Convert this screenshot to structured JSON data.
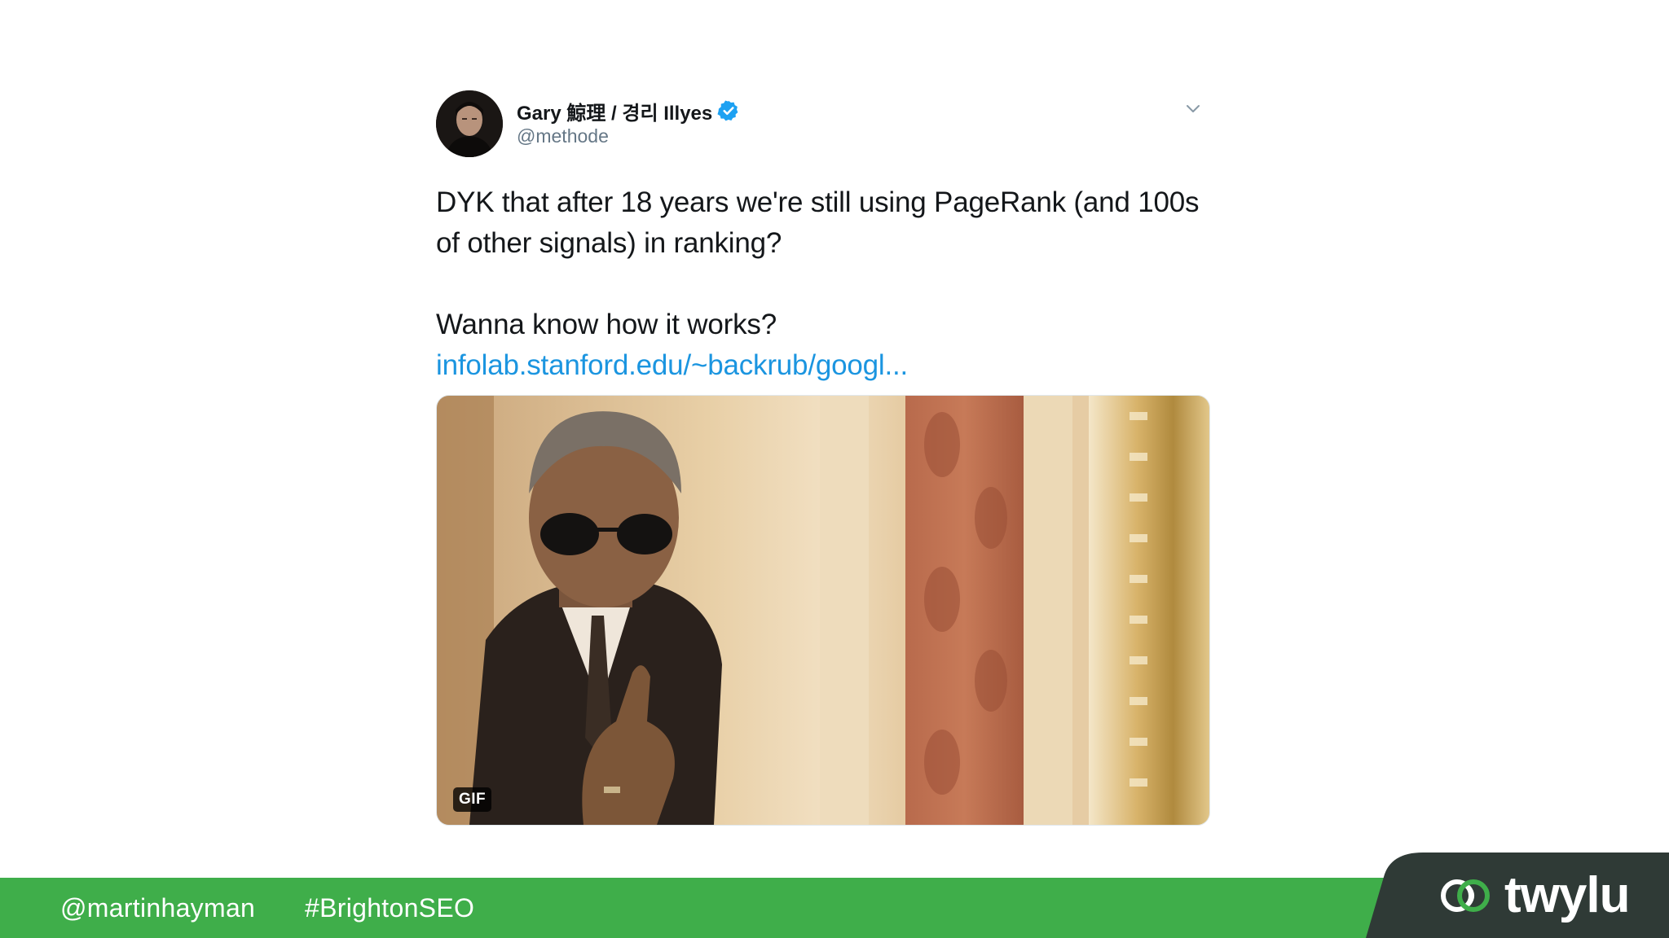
{
  "tweet": {
    "author_name": "Gary 鯨理 / 경리 Illyes",
    "handle": "@methode",
    "paragraph_1": "DYK that after 18 years we're still using PageRank (and 100s of other signals) in ranking?",
    "paragraph_2": "Wanna know how it works?",
    "link_text": "infolab.stanford.edu/~backrub/googl...",
    "media_badge": "GIF"
  },
  "footer": {
    "twitter_handle": "@martinhayman",
    "hashtag": "#BrightonSEO",
    "brand": "twylu"
  },
  "colors": {
    "link": "#1b95e0",
    "verified": "#1da1f2",
    "footer_green": "#3fae4a",
    "brand_tab": "#2f3a36",
    "text": "#14171a",
    "muted": "#657786"
  },
  "icons": {
    "verified": "verified-badge-icon",
    "menu": "chevron-down-icon",
    "logo": "twylu-logo-icon"
  }
}
